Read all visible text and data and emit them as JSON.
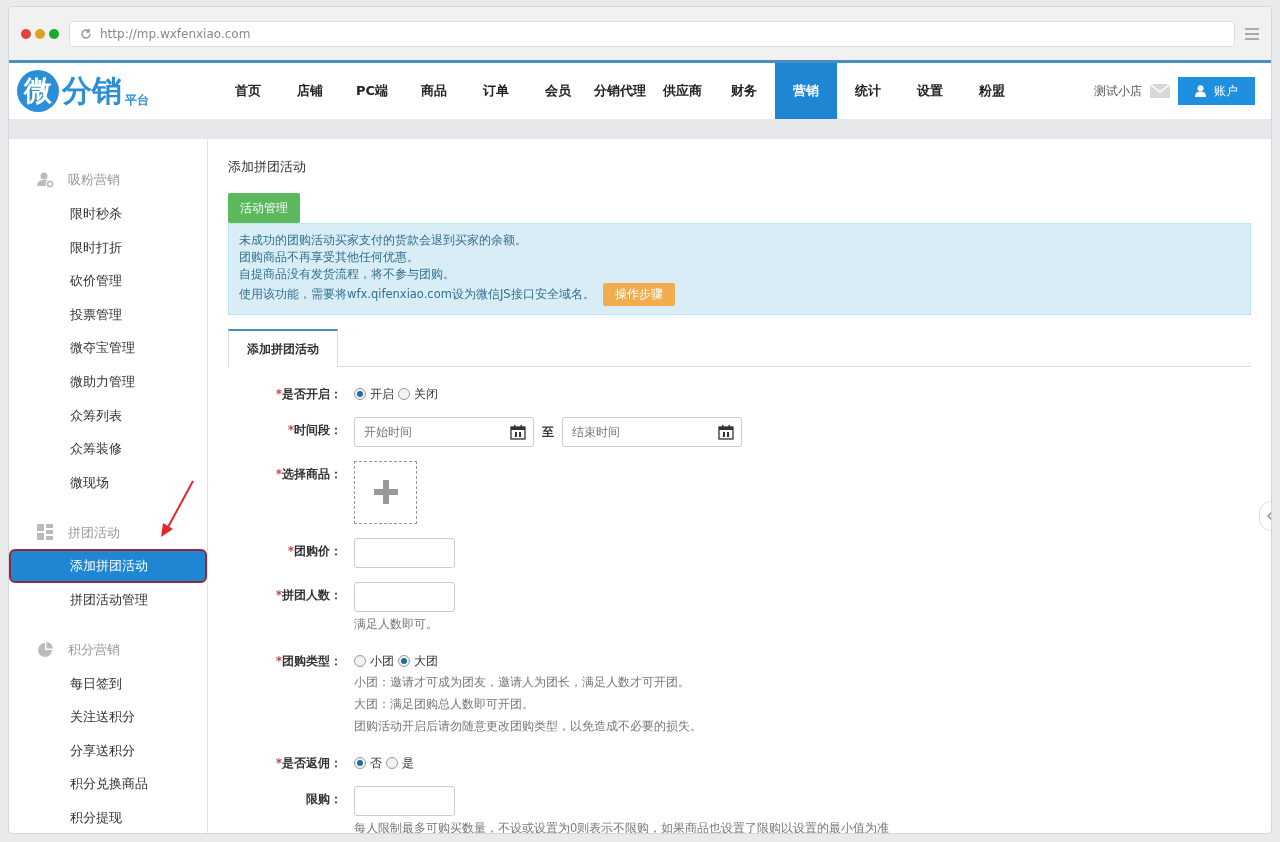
{
  "browser": {
    "url": "http://mp.wxfenxiao.com"
  },
  "header": {
    "logo": {
      "badge": "微",
      "text": "分销",
      "sub": "平台"
    },
    "nav": [
      {
        "label": "首页",
        "selected": false
      },
      {
        "label": "店铺",
        "selected": false
      },
      {
        "label": "PC端",
        "selected": false
      },
      {
        "label": "商品",
        "selected": false
      },
      {
        "label": "订单",
        "selected": false
      },
      {
        "label": "会员",
        "selected": false
      },
      {
        "label": "分销代理",
        "selected": false
      },
      {
        "label": "供应商",
        "selected": false
      },
      {
        "label": "财务",
        "selected": false
      },
      {
        "label": "营销",
        "selected": true
      },
      {
        "label": "统计",
        "selected": false
      },
      {
        "label": "设置",
        "selected": false
      },
      {
        "label": "粉盟",
        "selected": false
      }
    ],
    "shop_name": "测试小店",
    "account_button": "账户"
  },
  "sidebar": {
    "groups": [
      {
        "title": "吸粉营销",
        "kind": "fans",
        "items": [
          {
            "label": "限时秒杀",
            "selected": false
          },
          {
            "label": "限时打折",
            "selected": false
          },
          {
            "label": "砍价管理",
            "selected": false
          },
          {
            "label": "投票管理",
            "selected": false
          },
          {
            "label": "微夺宝管理",
            "selected": false
          },
          {
            "label": "微助力管理",
            "selected": false
          },
          {
            "label": "众筹列表",
            "selected": false
          },
          {
            "label": "众筹装修",
            "selected": false
          },
          {
            "label": "微现场",
            "selected": false
          }
        ]
      },
      {
        "title": "拼团活动",
        "kind": "group",
        "items": [
          {
            "label": "添加拼团活动",
            "selected": true
          },
          {
            "label": "拼团活动管理",
            "selected": false
          }
        ]
      },
      {
        "title": "积分营销",
        "kind": "points",
        "items": [
          {
            "label": "每日签到",
            "selected": false
          },
          {
            "label": "关注送积分",
            "selected": false
          },
          {
            "label": "分享送积分",
            "selected": false
          },
          {
            "label": "积分兑换商品",
            "selected": false
          },
          {
            "label": "积分提现",
            "selected": false
          }
        ]
      }
    ]
  },
  "content": {
    "title": "添加拼团活动",
    "manage_button": "活动管理",
    "notice": {
      "lines": [
        "未成功的团购活动买家支付的货款会退到买家的余额。",
        "团购商品不再享受其他任何优惠。",
        "自提商品没有发货流程，将不参与团购。",
        "使用该功能，需要将wfx.qifenxiao.com设为微信JS接口安全域名。"
      ],
      "step_button": "操作步骤"
    },
    "tabs": [
      {
        "label": "添加拼团活动",
        "selected": true
      }
    ],
    "form": [
      {
        "kind": "radio",
        "label": "是否开启：",
        "marker": "*",
        "options": [
          {
            "label": "开启",
            "selected": true
          },
          {
            "label": "关闭",
            "selected": false
          }
        ]
      },
      {
        "kind": "daterange",
        "label": "时间段：",
        "marker": "*",
        "start_placeholder": "开始时间",
        "separator": "至",
        "end_placeholder": "结束时间"
      },
      {
        "kind": "picker",
        "label": "选择商品：",
        "marker": "*"
      },
      {
        "kind": "text",
        "label": "团购价：",
        "marker": "*"
      },
      {
        "kind": "text",
        "label": "拼团人数：",
        "marker": "*",
        "hints": [
          "满足人数即可。"
        ]
      },
      {
        "kind": "radio",
        "label": "团购类型：",
        "marker": "*",
        "options": [
          {
            "label": "小团",
            "selected": false
          },
          {
            "label": "大团",
            "selected": true
          }
        ],
        "hints": [
          "小团：邀请才可成为团友，邀请人为团长，满足人数才可开团。",
          "大团：满足团购总人数即可开团。",
          "团购活动开启后请勿随意更改团购类型，以免造成不必要的损失。"
        ]
      },
      {
        "kind": "radio",
        "label": "是否返佣：",
        "marker": "*",
        "options": [
          {
            "label": "否",
            "selected": true
          },
          {
            "label": "是",
            "selected": false
          }
        ]
      },
      {
        "kind": "text",
        "label": "限购：",
        "hints": [
          "每人限制最多可购买数量，不设或设置为0则表示不限购，如果商品也设置了限购以设置的最小值为准"
        ]
      }
    ]
  }
}
